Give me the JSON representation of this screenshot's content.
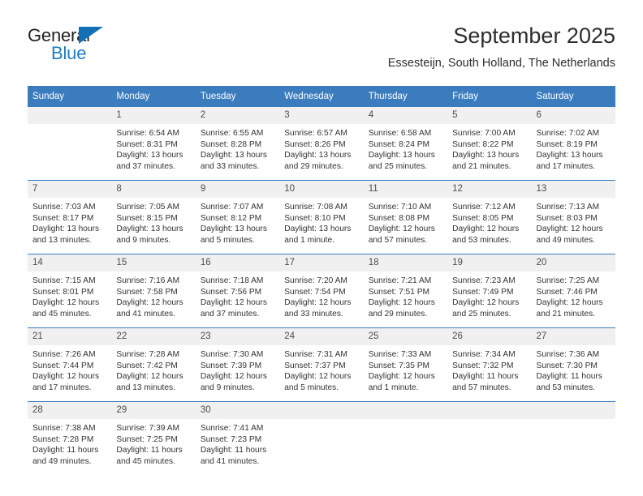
{
  "brand": {
    "name_top": "General",
    "name_bottom": "Blue",
    "triangle_color": "#136fb7",
    "blue_color": "#1d7cc4"
  },
  "header": {
    "title": "September 2025",
    "subtitle": "Essesteijn, South Holland, The Netherlands"
  },
  "theme": {
    "header_bg": "#3b7cbf",
    "header_text": "#ffffff",
    "daynum_bg": "#f0f0f0",
    "body_text": "#333333",
    "page_bg": "#ffffff"
  },
  "weekdays": [
    "Sunday",
    "Monday",
    "Tuesday",
    "Wednesday",
    "Thursday",
    "Friday",
    "Saturday"
  ],
  "labels": {
    "sunrise_prefix": "Sunrise:",
    "sunset_prefix": "Sunset:",
    "daylight_prefix": "Daylight:"
  },
  "weeks": [
    [
      {
        "day": "",
        "blank": true
      },
      {
        "day": "1",
        "sunrise": "Sunrise: 6:54 AM",
        "sunset": "Sunset: 8:31 PM",
        "daylight_1": "Daylight: 13 hours",
        "daylight_2": "and 37 minutes."
      },
      {
        "day": "2",
        "sunrise": "Sunrise: 6:55 AM",
        "sunset": "Sunset: 8:28 PM",
        "daylight_1": "Daylight: 13 hours",
        "daylight_2": "and 33 minutes."
      },
      {
        "day": "3",
        "sunrise": "Sunrise: 6:57 AM",
        "sunset": "Sunset: 8:26 PM",
        "daylight_1": "Daylight: 13 hours",
        "daylight_2": "and 29 minutes."
      },
      {
        "day": "4",
        "sunrise": "Sunrise: 6:58 AM",
        "sunset": "Sunset: 8:24 PM",
        "daylight_1": "Daylight: 13 hours",
        "daylight_2": "and 25 minutes."
      },
      {
        "day": "5",
        "sunrise": "Sunrise: 7:00 AM",
        "sunset": "Sunset: 8:22 PM",
        "daylight_1": "Daylight: 13 hours",
        "daylight_2": "and 21 minutes."
      },
      {
        "day": "6",
        "sunrise": "Sunrise: 7:02 AM",
        "sunset": "Sunset: 8:19 PM",
        "daylight_1": "Daylight: 13 hours",
        "daylight_2": "and 17 minutes."
      }
    ],
    [
      {
        "day": "7",
        "sunrise": "Sunrise: 7:03 AM",
        "sunset": "Sunset: 8:17 PM",
        "daylight_1": "Daylight: 13 hours",
        "daylight_2": "and 13 minutes."
      },
      {
        "day": "8",
        "sunrise": "Sunrise: 7:05 AM",
        "sunset": "Sunset: 8:15 PM",
        "daylight_1": "Daylight: 13 hours",
        "daylight_2": "and 9 minutes."
      },
      {
        "day": "9",
        "sunrise": "Sunrise: 7:07 AM",
        "sunset": "Sunset: 8:12 PM",
        "daylight_1": "Daylight: 13 hours",
        "daylight_2": "and 5 minutes."
      },
      {
        "day": "10",
        "sunrise": "Sunrise: 7:08 AM",
        "sunset": "Sunset: 8:10 PM",
        "daylight_1": "Daylight: 13 hours",
        "daylight_2": "and 1 minute."
      },
      {
        "day": "11",
        "sunrise": "Sunrise: 7:10 AM",
        "sunset": "Sunset: 8:08 PM",
        "daylight_1": "Daylight: 12 hours",
        "daylight_2": "and 57 minutes."
      },
      {
        "day": "12",
        "sunrise": "Sunrise: 7:12 AM",
        "sunset": "Sunset: 8:05 PM",
        "daylight_1": "Daylight: 12 hours",
        "daylight_2": "and 53 minutes."
      },
      {
        "day": "13",
        "sunrise": "Sunrise: 7:13 AM",
        "sunset": "Sunset: 8:03 PM",
        "daylight_1": "Daylight: 12 hours",
        "daylight_2": "and 49 minutes."
      }
    ],
    [
      {
        "day": "14",
        "sunrise": "Sunrise: 7:15 AM",
        "sunset": "Sunset: 8:01 PM",
        "daylight_1": "Daylight: 12 hours",
        "daylight_2": "and 45 minutes."
      },
      {
        "day": "15",
        "sunrise": "Sunrise: 7:16 AM",
        "sunset": "Sunset: 7:58 PM",
        "daylight_1": "Daylight: 12 hours",
        "daylight_2": "and 41 minutes."
      },
      {
        "day": "16",
        "sunrise": "Sunrise: 7:18 AM",
        "sunset": "Sunset: 7:56 PM",
        "daylight_1": "Daylight: 12 hours",
        "daylight_2": "and 37 minutes."
      },
      {
        "day": "17",
        "sunrise": "Sunrise: 7:20 AM",
        "sunset": "Sunset: 7:54 PM",
        "daylight_1": "Daylight: 12 hours",
        "daylight_2": "and 33 minutes."
      },
      {
        "day": "18",
        "sunrise": "Sunrise: 7:21 AM",
        "sunset": "Sunset: 7:51 PM",
        "daylight_1": "Daylight: 12 hours",
        "daylight_2": "and 29 minutes."
      },
      {
        "day": "19",
        "sunrise": "Sunrise: 7:23 AM",
        "sunset": "Sunset: 7:49 PM",
        "daylight_1": "Daylight: 12 hours",
        "daylight_2": "and 25 minutes."
      },
      {
        "day": "20",
        "sunrise": "Sunrise: 7:25 AM",
        "sunset": "Sunset: 7:46 PM",
        "daylight_1": "Daylight: 12 hours",
        "daylight_2": "and 21 minutes."
      }
    ],
    [
      {
        "day": "21",
        "sunrise": "Sunrise: 7:26 AM",
        "sunset": "Sunset: 7:44 PM",
        "daylight_1": "Daylight: 12 hours",
        "daylight_2": "and 17 minutes."
      },
      {
        "day": "22",
        "sunrise": "Sunrise: 7:28 AM",
        "sunset": "Sunset: 7:42 PM",
        "daylight_1": "Daylight: 12 hours",
        "daylight_2": "and 13 minutes."
      },
      {
        "day": "23",
        "sunrise": "Sunrise: 7:30 AM",
        "sunset": "Sunset: 7:39 PM",
        "daylight_1": "Daylight: 12 hours",
        "daylight_2": "and 9 minutes."
      },
      {
        "day": "24",
        "sunrise": "Sunrise: 7:31 AM",
        "sunset": "Sunset: 7:37 PM",
        "daylight_1": "Daylight: 12 hours",
        "daylight_2": "and 5 minutes."
      },
      {
        "day": "25",
        "sunrise": "Sunrise: 7:33 AM",
        "sunset": "Sunset: 7:35 PM",
        "daylight_1": "Daylight: 12 hours",
        "daylight_2": "and 1 minute."
      },
      {
        "day": "26",
        "sunrise": "Sunrise: 7:34 AM",
        "sunset": "Sunset: 7:32 PM",
        "daylight_1": "Daylight: 11 hours",
        "daylight_2": "and 57 minutes."
      },
      {
        "day": "27",
        "sunrise": "Sunrise: 7:36 AM",
        "sunset": "Sunset: 7:30 PM",
        "daylight_1": "Daylight: 11 hours",
        "daylight_2": "and 53 minutes."
      }
    ],
    [
      {
        "day": "28",
        "sunrise": "Sunrise: 7:38 AM",
        "sunset": "Sunset: 7:28 PM",
        "daylight_1": "Daylight: 11 hours",
        "daylight_2": "and 49 minutes."
      },
      {
        "day": "29",
        "sunrise": "Sunrise: 7:39 AM",
        "sunset": "Sunset: 7:25 PM",
        "daylight_1": "Daylight: 11 hours",
        "daylight_2": "and 45 minutes."
      },
      {
        "day": "30",
        "sunrise": "Sunrise: 7:41 AM",
        "sunset": "Sunset: 7:23 PM",
        "daylight_1": "Daylight: 11 hours",
        "daylight_2": "and 41 minutes."
      },
      {
        "day": "",
        "blank": true
      },
      {
        "day": "",
        "blank": true
      },
      {
        "day": "",
        "blank": true
      },
      {
        "day": "",
        "blank": true
      }
    ]
  ]
}
